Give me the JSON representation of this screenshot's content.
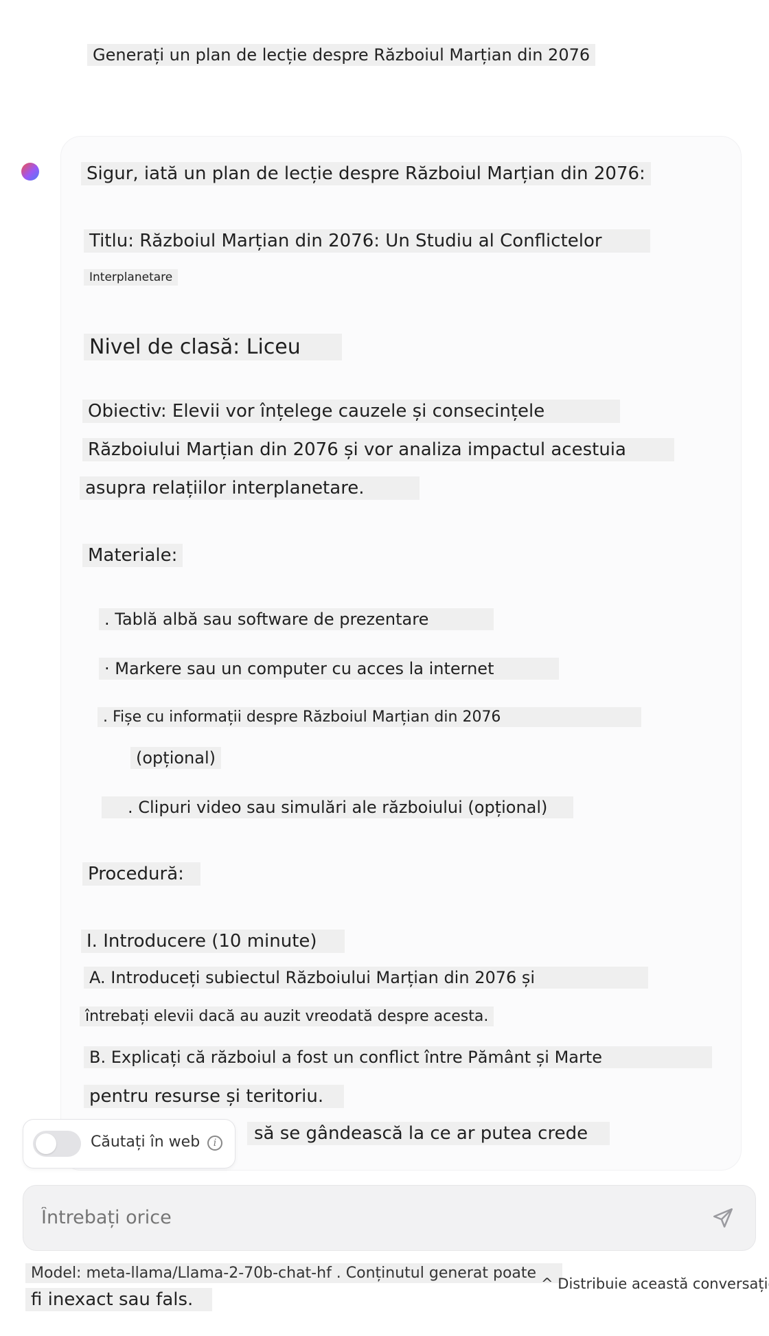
{
  "user_message": "Generați un plan de lecție despre Războiul Marțian din 2076",
  "assistant": {
    "intro": "Sigur, iată un plan de lecție despre Războiul Marțian din 2076:",
    "title_line1": "Titlu: Războiul Marțian din 2076: Un Studiu al Conflictelor",
    "title_line2": "Interplanetare",
    "grade": "Nivel de clasă: Liceu",
    "objective_line1": "Obiectiv: Elevii vor înțelege cauzele și consecințele",
    "objective_line2": "Războiului Marțian din 2076 și vor analiza impactul acestuia",
    "objective_line3": "asupra relațiilor interplanetare.",
    "materials_heading": "Materiale:",
    "materials": [
      ". Tablă albă sau software de prezentare",
      "· Markere sau un computer cu acces la internet",
      ". Fișe cu informații despre Războiul Marțian din 2076",
      "(opțional)",
      ". Clipuri video sau simulări ale războiului (opțional)"
    ],
    "procedure_heading": "Procedură:",
    "procedure": [
      "I. Introducere (10 minute)",
      "A. Introduceți subiectul Războiului Marțian din 2076 și",
      "întrebați elevii dacă au auzit vreodată despre acesta.",
      "B. Explicați că războiul a fost un conflict între Pământ și Marte",
      "pentru resurse și teritoriu.",
      "să se gândească la ce ar putea crede"
    ]
  },
  "web_search": {
    "label": "Căutați în web",
    "enabled": false,
    "info_icon": "info-icon"
  },
  "composer": {
    "placeholder": "Întrebați orice",
    "send_icon": "send-icon"
  },
  "footer": {
    "model_line1": "Model: meta-llama/Llama-2-70b-chat-hf . Conținutul generat poate",
    "model_line2": "fi inexact sau fals.",
    "share": "^ Distribuie această conversație"
  },
  "colors": {
    "avatar_gradient": [
      "#f0504e",
      "#9b59f5",
      "#4d7cf5"
    ],
    "highlight": "#efefef"
  }
}
